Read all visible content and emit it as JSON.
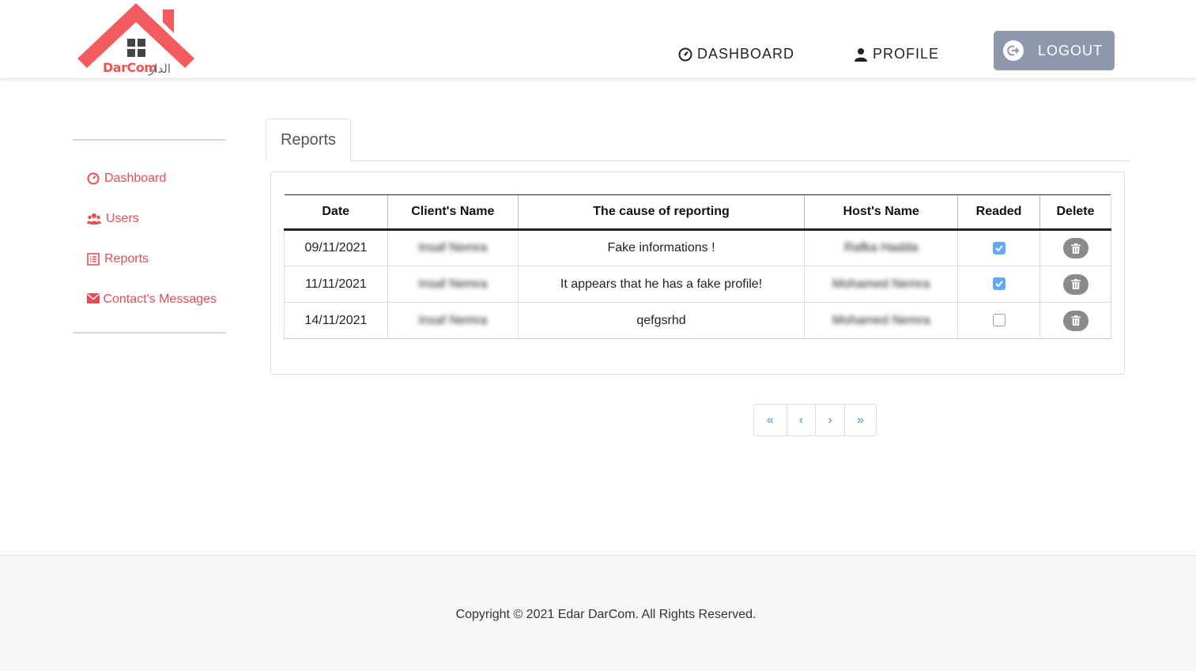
{
  "header": {
    "logo_text": "DarCom",
    "logo_arabic": "الدار",
    "nav": {
      "dashboard_label": "DASHBOARD",
      "profile_label": "PROFILE",
      "logout_label": "LOGOUT"
    }
  },
  "sidebar": {
    "items": [
      {
        "label": "Dashboard",
        "icon": "dashboard-icon"
      },
      {
        "label": "Users",
        "icon": "users-icon"
      },
      {
        "label": "Reports",
        "icon": "list-icon"
      },
      {
        "label": "Contact's Messages",
        "icon": "envelope-icon"
      }
    ]
  },
  "tabs": {
    "active_label": "Reports"
  },
  "table": {
    "headers": [
      "Date",
      "Client's Name",
      "The cause of reporting",
      "Host's Name",
      "Readed",
      "Delete"
    ],
    "rows": [
      {
        "date": "09/11/2021",
        "client": "Insaf Nemra",
        "cause": "Fake informations !",
        "host": "Rafka Hadda",
        "readed": true
      },
      {
        "date": "11/11/2021",
        "client": "Insaf Nemra",
        "cause": "It appears that he has a fake profile!",
        "host": "Mohamed Nemra",
        "readed": true
      },
      {
        "date": "14/11/2021",
        "client": "Insaf Nemra",
        "cause": "qefgsrhd",
        "host": "Mohamed Nemra",
        "readed": false
      }
    ]
  },
  "pagination": {
    "first": "«",
    "prev": "‹",
    "next": "›",
    "last": "»"
  },
  "footer": {
    "copyright": "Copyright © 2021 Edar DarCom. All Rights Reserved."
  },
  "colors": {
    "accent": "#e94b55",
    "logout_bg": "#8d97ad",
    "checkbox_checked": "#64a9f5",
    "link": "#4a90c9"
  }
}
